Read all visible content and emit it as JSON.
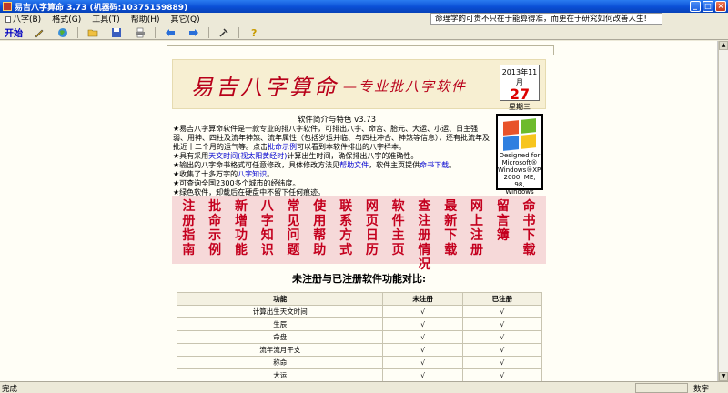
{
  "window": {
    "title": "易吉八字算命 3.73 (机器码:10375159889)",
    "minimize": "_",
    "maximize": "□",
    "close": "×"
  },
  "menu": {
    "items": [
      "八字(B)",
      "格式(G)",
      "工具(T)",
      "帮助(H)",
      "其它(Q)"
    ],
    "marquee": "命理学的可贵不只在于能算得准，而更在于研究如何改善人生!"
  },
  "toolbar": {
    "start_label": "开始"
  },
  "banner": {
    "logo": "易吉八字算命",
    "subtitle": "—专业批八字软件",
    "date_ym": "2013年11月",
    "date_day": "27",
    "date_weekday": "星期三"
  },
  "intro": {
    "heading": "软件简介与特色 v3.73",
    "lines": [
      "★易吉八字算命软件是一款专业的排八字软件，可排出八字、命宫、胎元、大运、小运、日主强弱、用神、四柱及流年神煞、流年属性（包括岁运并临、与四柱冲合、神煞等信息），还有批流年及批近十二个月的运气等。点击",
      "批命示例",
      "可以看到本软件排出的八字样本。",
      "★具有采用",
      "天文时间(视太阳黄经时)",
      "计算出生时间，确保排出八字的准确性。",
      "★输出的八字命书格式可任意修改，具体修改方法见",
      "帮助文件",
      "，软件主页提供",
      "命书下载",
      "。",
      "★收集了十多万字的",
      "八字知识",
      "。",
      "★可查询全国2300多个城市的经纬度。",
      "★绿色软件，卸载后在硬盘中不留下任何痕迹。"
    ]
  },
  "xp_badge": {
    "designed": "Designed for",
    "ms": "Microsoft®",
    "xp": "Windows®XP,",
    "others": "2000, ME, 98,",
    "nt": "Windows NT®"
  },
  "nav": [
    "注册指南",
    "批命示例",
    "新增功能",
    "八字知识",
    "常见问题",
    "使用帮助",
    "联系方式",
    "网页日历",
    "软件主页",
    "查注册情况",
    "最新下载",
    "网上注册",
    "留言簿",
    "命书下载"
  ],
  "compare": {
    "title": "未注册与已注册软件功能对比:",
    "headers": [
      "功能",
      "未注册",
      "已注册"
    ],
    "rows": [
      [
        "计算出生天文时间",
        "√",
        "√"
      ],
      [
        "生辰",
        "√",
        "√"
      ],
      [
        "命盘",
        "√",
        "√"
      ],
      [
        "流年流月干支",
        "√",
        "√"
      ],
      [
        "称命",
        "√",
        "√"
      ],
      [
        "大运",
        "√",
        "√"
      ]
    ]
  },
  "status": {
    "left": "完成",
    "numlock": "数字"
  }
}
